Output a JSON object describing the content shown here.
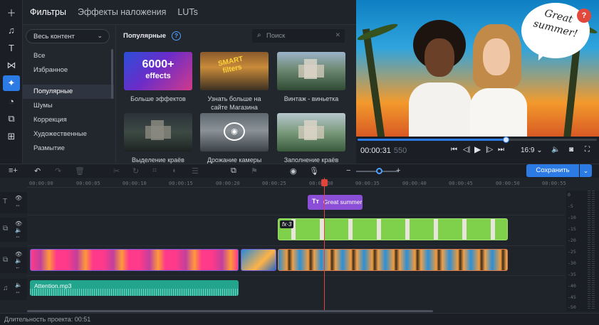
{
  "toolbar": {
    "icons": [
      "plus-icon",
      "music-icon",
      "text-icon",
      "transitions-icon",
      "filters-icon",
      "clock-icon",
      "stickers-icon",
      "more-tools-icon"
    ]
  },
  "tabs": [
    {
      "label": "Фильтры",
      "active": true
    },
    {
      "label": "Эффекты наложения",
      "active": false
    },
    {
      "label": "LUTs",
      "active": false
    }
  ],
  "panel": {
    "category_select": "Весь контент",
    "categories_top": [
      "Все",
      "Избранное"
    ],
    "categories": [
      "Популярные",
      "Шумы",
      "Коррекция",
      "Художественные",
      "Размытие"
    ],
    "section_title": "Популярные",
    "search": {
      "placeholder": "Поиск",
      "value": ""
    },
    "cards": [
      {
        "label": "Больше эффектов",
        "badge_big": "6000+",
        "badge_small": "effects"
      },
      {
        "label": "Узнать больше на сайте Магазина",
        "badge": "SMART filters"
      },
      {
        "label": "Винтаж - виньетка"
      },
      {
        "label": "Выделение краёв"
      },
      {
        "label": "Дрожание камеры"
      },
      {
        "label": "Заполнение краёв"
      }
    ]
  },
  "preview": {
    "bubble_text": "Great summer!",
    "help": "?",
    "time_current": "00:00:31",
    "time_total": "550",
    "progress": 0.62,
    "aspect_ratio": "16:9"
  },
  "timeline_toolbar": {
    "save_label": "Сохранить"
  },
  "timeline": {
    "ruler": [
      "00:00:00",
      "00:00:05",
      "00:00:10",
      "00:00:15",
      "00:00:20",
      "00:00:25",
      "00:00:30",
      "00:00:35",
      "00:00:40",
      "00:00:45",
      "00:00:50",
      "00:00:55"
    ],
    "title_clip": "Great summer!",
    "fx_badge": "fx·3",
    "audio_clip": "Attention.mp3",
    "meter_labels": [
      "0",
      "-5",
      "-10",
      "-15",
      "-20",
      "-25",
      "-30",
      "-35",
      "-40",
      "-45",
      "-50"
    ]
  },
  "status": {
    "duration": "Длительность проекта: 00:51"
  },
  "colors": {
    "accent": "#2c7be5",
    "playhead": "#e0443a",
    "title_clip": "#8a4fd6",
    "audio_clip": "#22a58c"
  }
}
